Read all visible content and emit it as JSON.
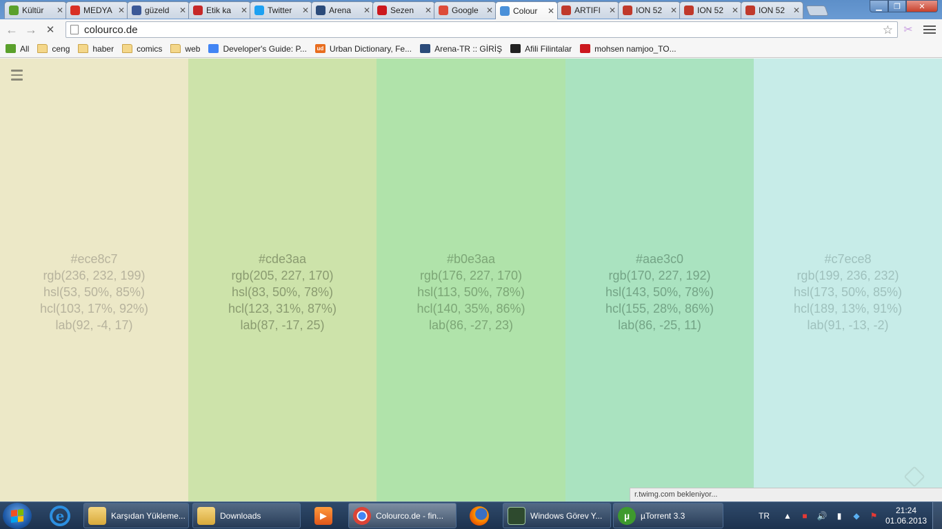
{
  "browser": {
    "tabs": [
      {
        "title": "Kültür",
        "icon": "leaf-icon",
        "color": "#5aa02c"
      },
      {
        "title": "MEDYA",
        "icon": "gmail-icon",
        "color": "#d93025"
      },
      {
        "title": "güzeld",
        "icon": "facebook-icon",
        "color": "#3b5998"
      },
      {
        "title": "Etik ka",
        "icon": "bookmark-red-icon",
        "color": "#c62828"
      },
      {
        "title": "Twitter",
        "icon": "twitter-icon",
        "color": "#1da1f2"
      },
      {
        "title": "Arena",
        "icon": "arena-icon",
        "color": "#2b4b7a"
      },
      {
        "title": "Sezen",
        "icon": "youtube-icon",
        "color": "#cc181e"
      },
      {
        "title": "Google",
        "icon": "google-plus-icon",
        "color": "#dd4b39"
      },
      {
        "title": "Colour",
        "icon": "loading-icon",
        "color": "#4a90d9",
        "active": true
      },
      {
        "title": "ARTIFI",
        "icon": "ion-icon",
        "color": "#c0392b"
      },
      {
        "title": "ION 52",
        "icon": "ion-icon",
        "color": "#c0392b"
      },
      {
        "title": "ION 52",
        "icon": "ion-icon",
        "color": "#c0392b"
      },
      {
        "title": "ION 52",
        "icon": "ion-icon",
        "color": "#c0392b"
      }
    ],
    "tab_close": "✕",
    "back": "←",
    "forward": "→",
    "stop": "✕",
    "url": "colourco.de",
    "star": "☆",
    "bookmarks": [
      {
        "label": "All",
        "icon": "leaf-icon",
        "kind": "app",
        "color": "#5aa02c"
      },
      {
        "label": "ceng",
        "icon": "folder-icon",
        "kind": "folder"
      },
      {
        "label": "haber",
        "icon": "folder-icon",
        "kind": "folder"
      },
      {
        "label": "comics",
        "icon": "folder-icon",
        "kind": "folder"
      },
      {
        "label": "web",
        "icon": "folder-icon",
        "kind": "folder"
      },
      {
        "label": "Developer's Guide: P...",
        "icon": "google-code-icon",
        "kind": "app",
        "color": "#4285f4"
      },
      {
        "label": "Urban Dictionary, Fe...",
        "icon": "urban-dictionary-icon",
        "kind": "app",
        "color": "#e86d1f",
        "glyph": "ud"
      },
      {
        "label": "Arena-TR :: GİRİŞ",
        "icon": "arena-icon",
        "kind": "app",
        "color": "#2b4b7a"
      },
      {
        "label": "Afili Filintalar",
        "icon": "afili-icon",
        "kind": "app",
        "color": "#222222"
      },
      {
        "label": "mohsen namjoo_TO...",
        "icon": "youtube-icon",
        "kind": "app",
        "color": "#cc181e"
      }
    ]
  },
  "palette": [
    {
      "hex": "#ece8c7",
      "rgb": "rgb(236, 232, 199)",
      "hsl": "hsl(53, 50%, 85%)",
      "hcl": "hcl(103, 17%, 92%)",
      "lab": "lab(92, -4, 17)",
      "text_color": "#b7b39d"
    },
    {
      "hex": "#cde3aa",
      "rgb": "rgb(205, 227, 170)",
      "hsl": "hsl(83, 50%, 78%)",
      "hcl": "hcl(123, 31%, 87%)",
      "lab": "lab(87, -17, 25)",
      "text_color": "#8a9b70"
    },
    {
      "hex": "#b0e3aa",
      "rgb": "rgb(176, 227, 170)",
      "hsl": "hsl(113, 50%, 78%)",
      "hcl": "hcl(140, 35%, 86%)",
      "lab": "lab(86, -27, 23)",
      "text_color": "#7ca676"
    },
    {
      "hex": "#aae3c0",
      "rgb": "rgb(170, 227, 192)",
      "hsl": "hsl(143, 50%, 78%)",
      "hcl": "hcl(155, 28%, 86%)",
      "lab": "lab(86, -25, 11)",
      "text_color": "#74a486"
    },
    {
      "hex": "#c7ece8",
      "rgb": "rgb(199, 236, 232)",
      "hsl": "hsl(173, 50%, 85%)",
      "hcl": "hcl(189, 13%, 91%)",
      "lab": "lab(91, -13, -2)",
      "text_color": "#9fc1bd"
    }
  ],
  "status_text": "r.twimg.com bekleniyor...",
  "taskbar": {
    "items": [
      {
        "type": "icon",
        "name": "internet-explorer-icon"
      },
      {
        "type": "button",
        "label": "Karşıdan Yükleme...",
        "icon": "folder-icon"
      },
      {
        "type": "button",
        "label": "Downloads",
        "icon": "folder-icon"
      },
      {
        "type": "icon",
        "name": "media-player-icon"
      },
      {
        "type": "button",
        "label": "Colourco.de - fin...",
        "icon": "chrome-icon",
        "active": true
      },
      {
        "type": "icon",
        "name": "firefox-icon"
      },
      {
        "type": "button",
        "label": "Windows Görev Y...",
        "icon": "task-manager-icon"
      },
      {
        "type": "button",
        "label": "µTorrent 3.3",
        "icon": "utorrent-icon"
      }
    ],
    "language": "TR",
    "time": "21:24",
    "date": "01.06.2013"
  }
}
